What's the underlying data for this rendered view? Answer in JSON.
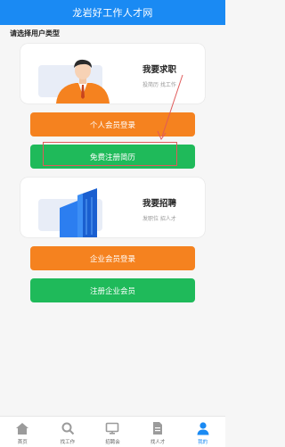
{
  "header": {
    "title": "龙岩好工作人才网"
  },
  "subtitle": "请选择用户类型",
  "job_seeker": {
    "title": "我要求职",
    "subtitle": "投简历 找工作",
    "login_label": "个人会员登录",
    "register_label": "免费注册简历"
  },
  "employer": {
    "title": "我要招聘",
    "subtitle": "发职位 招人才",
    "login_label": "企业会员登录",
    "register_label": "注册企业会员"
  },
  "colors": {
    "header": "#1a8af3",
    "orange_button": "#f5821f",
    "green_button": "#1fba5a",
    "active_tab": "#1a8af3"
  },
  "tabs": [
    {
      "label": "首页",
      "icon": "home-icon",
      "active": false
    },
    {
      "label": "找工作",
      "icon": "search-icon",
      "active": false
    },
    {
      "label": "招聘会",
      "icon": "monitor-icon",
      "active": false
    },
    {
      "label": "找人才",
      "icon": "resume-icon",
      "active": false
    },
    {
      "label": "我的",
      "icon": "user-icon",
      "active": true
    }
  ]
}
